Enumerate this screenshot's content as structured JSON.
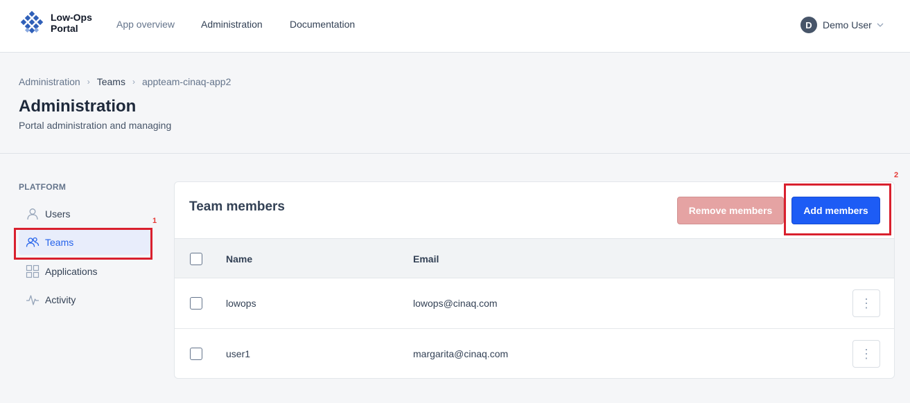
{
  "app": {
    "logo_line1": "Low-Ops",
    "logo_line2": "Portal"
  },
  "nav": {
    "items": [
      "App overview",
      "Administration",
      "Documentation"
    ]
  },
  "user": {
    "initial": "D",
    "name": "Demo User"
  },
  "breadcrumb": [
    "Administration",
    "Teams",
    "appteam-cinaq-app2"
  ],
  "page": {
    "title": "Administration",
    "subtitle": "Portal administration and managing"
  },
  "sidebar": {
    "heading": "PLATFORM",
    "items": [
      {
        "label": "Users",
        "icon": "user-icon"
      },
      {
        "label": "Teams",
        "icon": "users-icon"
      },
      {
        "label": "Applications",
        "icon": "grid-icon"
      },
      {
        "label": "Activity",
        "icon": "activity-icon"
      }
    ],
    "active": "Teams"
  },
  "annotations": {
    "marker1": "1",
    "marker2": "2"
  },
  "card": {
    "title": "Team members",
    "remove_button": "Remove members",
    "add_button": "Add members",
    "columns": [
      "Name",
      "Email"
    ],
    "rows": [
      {
        "name": "lowops",
        "email": "lowops@cinaq.com"
      },
      {
        "name": "user1",
        "email": "margarita@cinaq.com"
      }
    ],
    "row_menu_glyph": "⋮"
  },
  "colors": {
    "primary": "#1d5cf5",
    "danger_disabled": "#e5a3a3",
    "highlight": "#d9202e"
  }
}
